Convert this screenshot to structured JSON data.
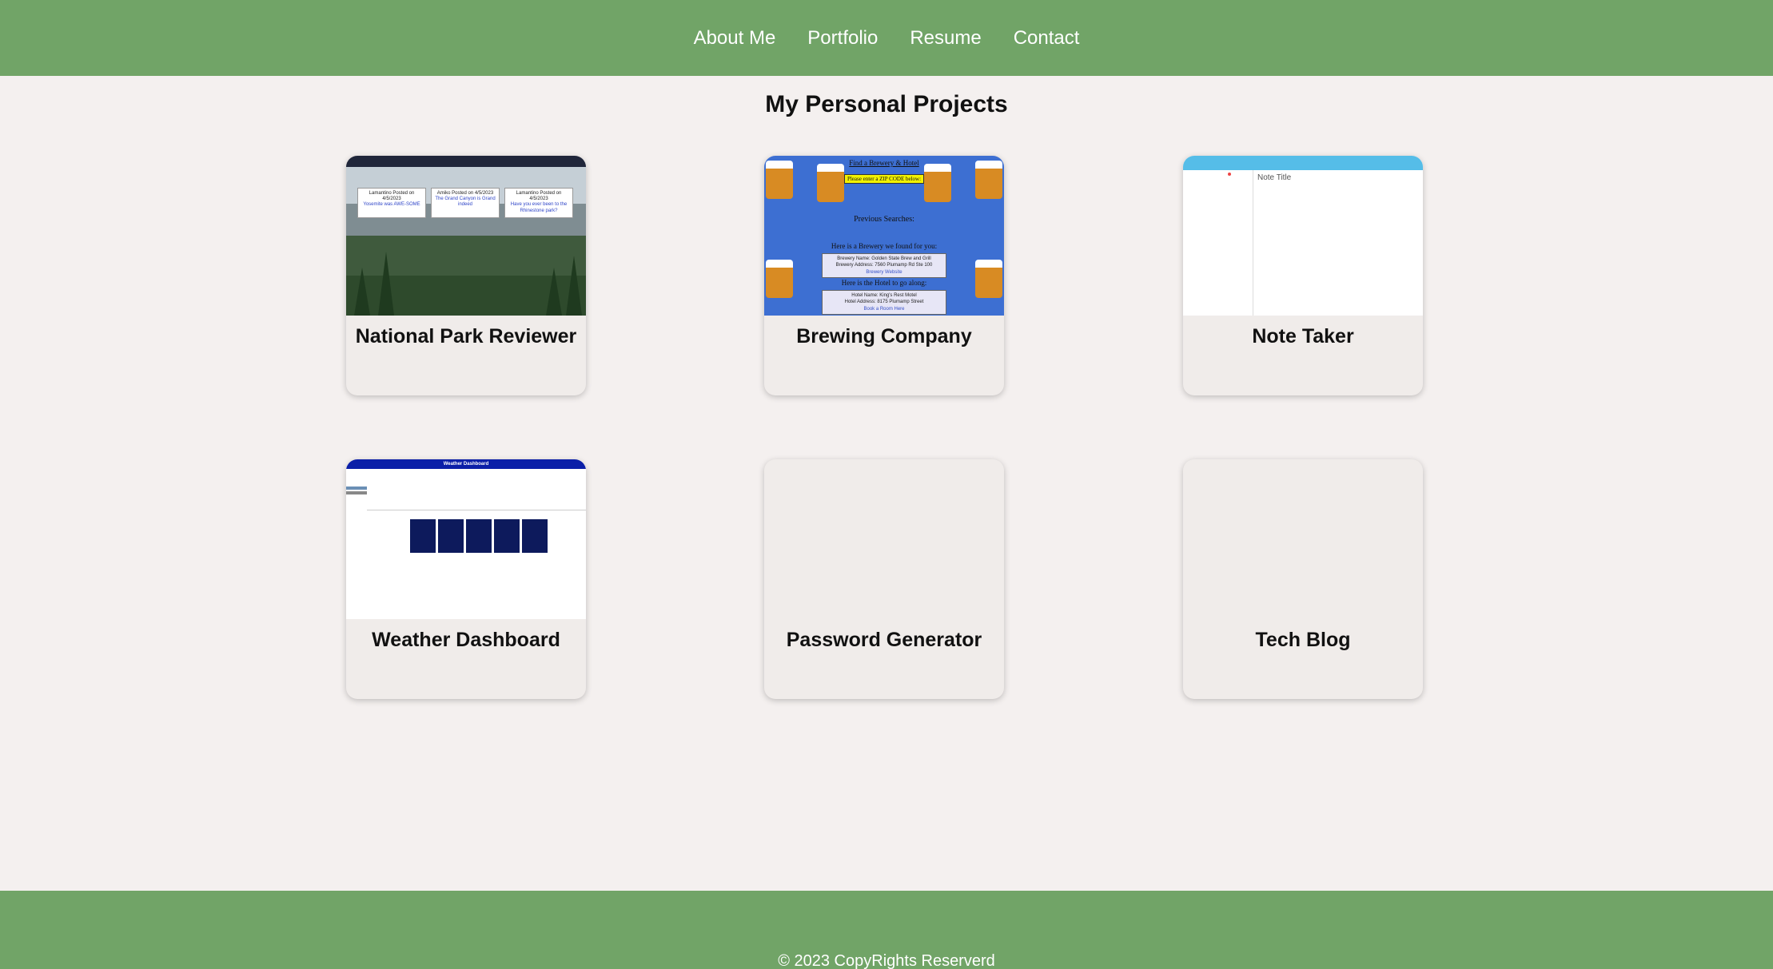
{
  "nav": {
    "items": [
      {
        "label": "About Me"
      },
      {
        "label": "Portfolio"
      },
      {
        "label": "Resume"
      },
      {
        "label": "Contact"
      }
    ]
  },
  "main": {
    "title": "My Personal Projects",
    "projects": [
      {
        "title": "National Park Reviewer"
      },
      {
        "title": "Brewing Company"
      },
      {
        "title": "Note Taker"
      },
      {
        "title": "Weather Dashboard"
      },
      {
        "title": "Password Generator"
      },
      {
        "title": "Tech Blog"
      }
    ]
  },
  "thumbs": {
    "park": {
      "cards": [
        {
          "author": "Lamantino Posted on 4/5/2023",
          "link": "Yosemite was AWE-SOME"
        },
        {
          "author": "Amiko Posted on 4/5/2023",
          "link": "The Grand Canyon is Grand indeed"
        },
        {
          "author": "Lamantino Posted on 4/5/2023",
          "link": "Have you ever been to the Rhinestone park?"
        }
      ]
    },
    "brew": {
      "heading": "Find a Brewery & Hotel",
      "zip_prompt": "Please enter a ZIP CODE below:",
      "previous": "Previous Searches:",
      "brewery_heading": "Here is a Brewery we found for you:",
      "brewery_name": "Brewery Name: Golden State Brew and Grill",
      "brewery_address": "Brewery Address: 7560 Plumamp Rd Ste 100",
      "brewery_link": "Brewery Website",
      "hotel_heading": "Here is the Hotel to go along:",
      "hotel_name": "Hotel Name: King's Rest Motel",
      "hotel_address": "Hotel Address: 8175 Plumamp Street",
      "hotel_link": "Book a Room Here"
    },
    "note": {
      "title": "Note Title"
    },
    "weather": {
      "header": "Weather Dashboard"
    }
  },
  "footer": {
    "text": "© 2023 CopyRights Reserverd"
  }
}
